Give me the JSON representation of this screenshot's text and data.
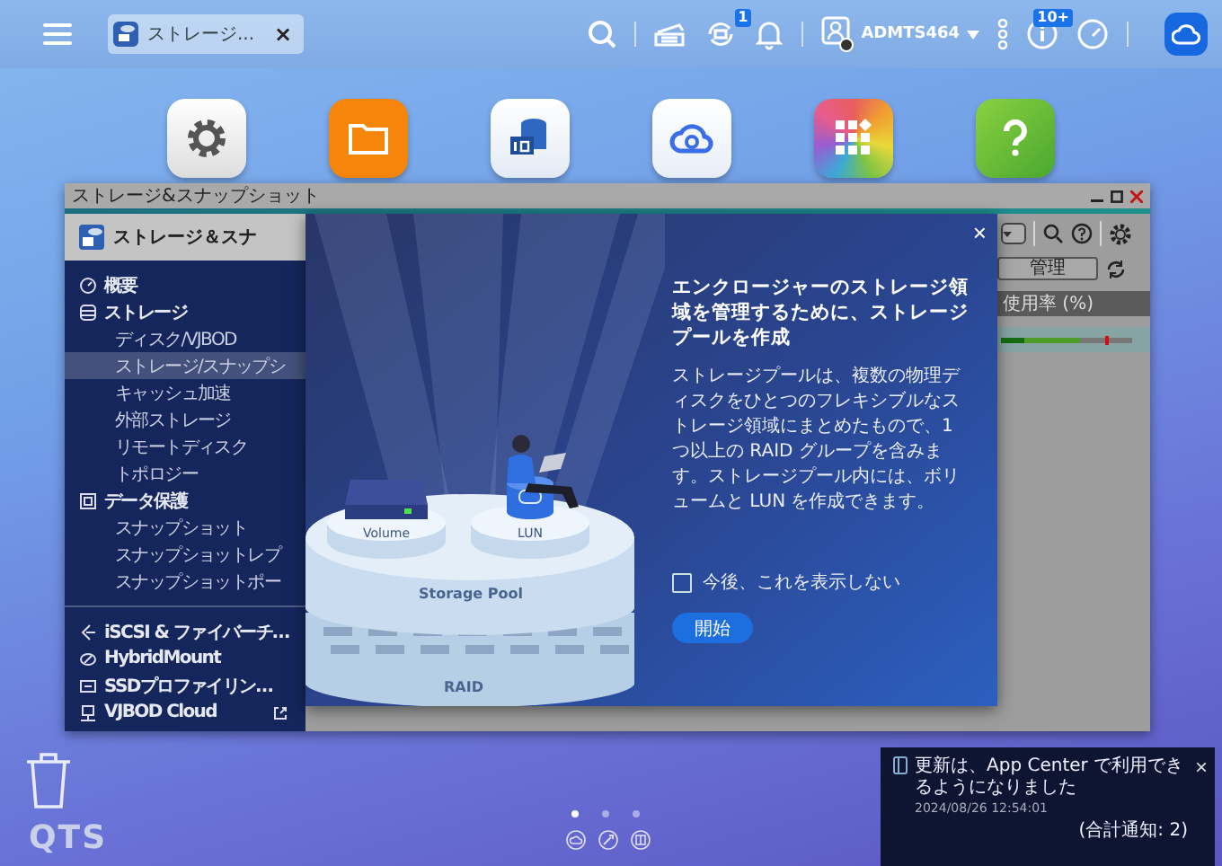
{
  "top_bar": {
    "tab": {
      "label": "ストレージ...",
      "close": "×",
      "selected": true
    },
    "sync_badge": "1",
    "user": "ADMTS464",
    "info_badge": "10+"
  },
  "desktop_apps": [
    {
      "kind": "settings"
    },
    {
      "kind": "files"
    },
    {
      "kind": "storage"
    },
    {
      "kind": "cloud"
    },
    {
      "kind": "appcenter"
    },
    {
      "kind": "help"
    }
  ],
  "window": {
    "title": "ストレージ&スナップショット",
    "app_name": "ストレージ＆スナ",
    "sidebar_groups": [
      [
        {
          "label": "概要",
          "selected": false
        },
        {
          "label": "ストレージ",
          "selected": false,
          "children": [
            {
              "label": "ディスク/VJBOD",
              "selected": false
            },
            {
              "label": "ストレージ/スナップシ",
              "selected": true
            },
            {
              "label": "キャッシュ加速",
              "selected": false
            },
            {
              "label": "外部ストレージ",
              "selected": false
            },
            {
              "label": "リモートディスク",
              "selected": false
            },
            {
              "label": "トポロジー",
              "selected": false
            }
          ]
        },
        {
          "label": "データ保護",
          "selected": false,
          "children": [
            {
              "label": "スナップショット",
              "selected": false
            },
            {
              "label": "スナップショットレプ",
              "selected": false
            },
            {
              "label": "スナップショットポー",
              "selected": false
            }
          ]
        }
      ],
      [
        {
          "label": "iSCSI & ファイバーチ…",
          "selected": false,
          "external": false
        },
        {
          "label": "HybridMount",
          "selected": false,
          "external": false
        },
        {
          "label": "SSDプロファイリン…",
          "selected": false,
          "external": false
        },
        {
          "label": "VJBOD Cloud",
          "selected": false,
          "external": true
        }
      ]
    ],
    "manage_button": "管理",
    "table_header": "使用率 (%)",
    "usage": {
      "level": 0.6
    }
  },
  "dialog": {
    "close": "×",
    "title": "エンクロージャーのストレージ領域を管理するために、ストレージプールを作成",
    "body": "ストレージプールは、複数の物理ディスクをひとつのフレキシブルなストレージ領域にまとめたもので、1 つ以上の RAID グループを含みます。ストレージプール内には、ボリュームと LUN を作成できます。",
    "dont_show_again": {
      "label": "今後、これを表示しない",
      "checked": false
    },
    "start_button": "開始",
    "illustration_labels": [
      "Volume",
      "LUN",
      "Storage Pool",
      "RAID"
    ]
  },
  "desktop": {
    "logo": "QTS",
    "pages": [
      {
        "selected": true
      },
      {
        "selected": false
      },
      {
        "selected": false
      }
    ]
  },
  "notification": {
    "message": "更新は、App Center で利用できるようになりました",
    "time": "2024/08/26 12:54:01",
    "total": "(合計通知: 2)",
    "close": "×"
  }
}
